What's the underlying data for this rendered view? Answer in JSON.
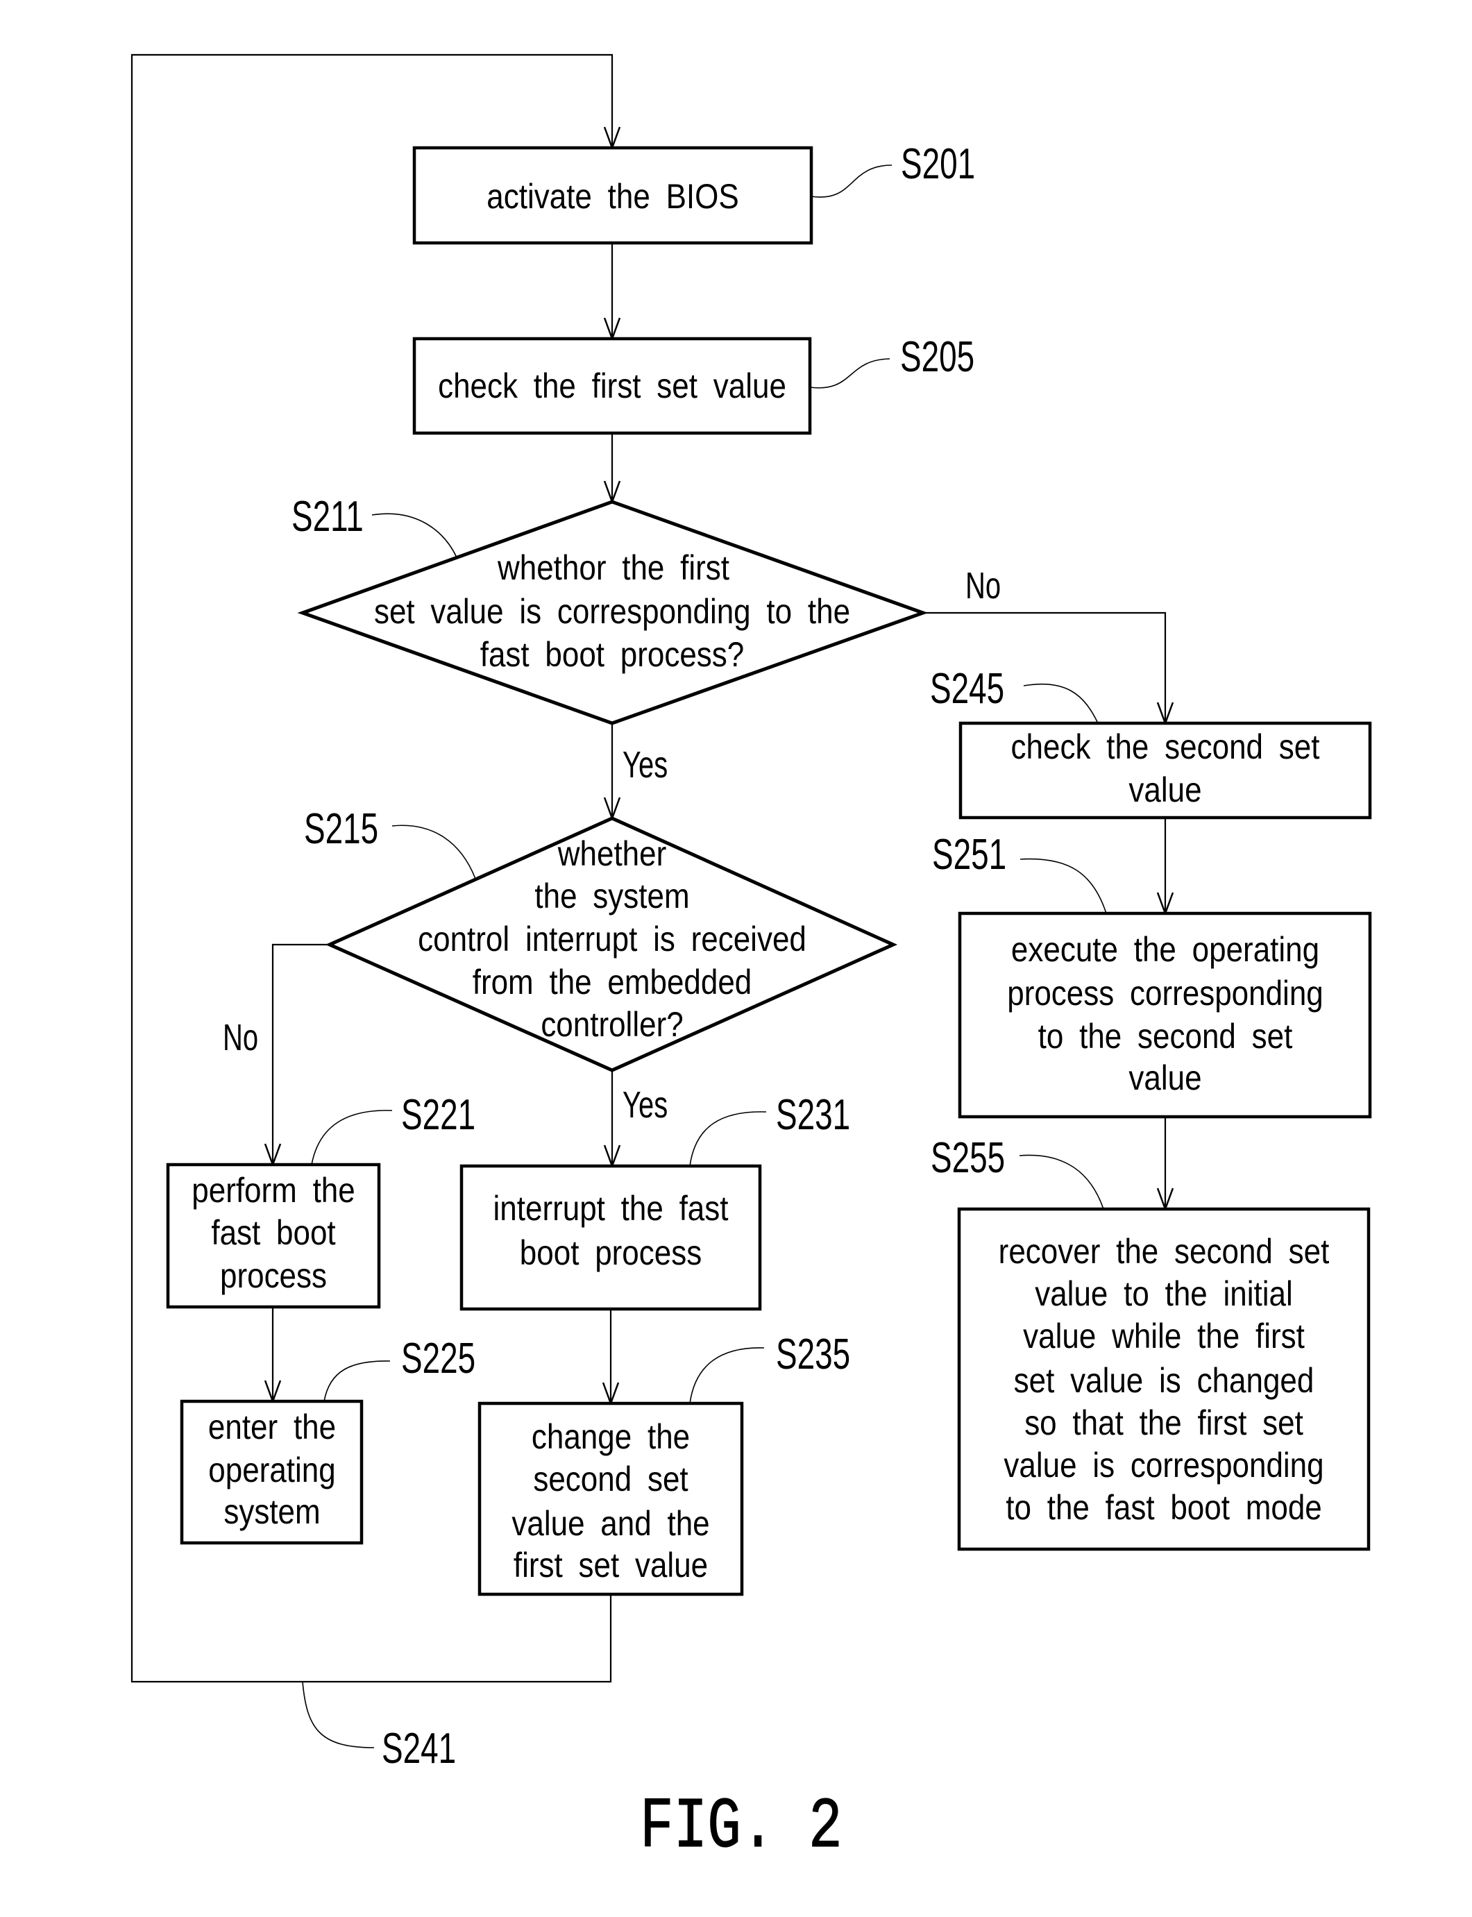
{
  "figure": {
    "caption": "FIG. 2"
  },
  "steps": {
    "S201": {
      "id": "S201",
      "type": "process",
      "lines": [
        "activate the BIOS"
      ]
    },
    "S205": {
      "id": "S205",
      "type": "process",
      "lines": [
        "check the first set value"
      ]
    },
    "S211": {
      "id": "S211",
      "type": "decision",
      "lines": [
        "whethor the first",
        "set value is corresponding to the",
        "fast boot process?"
      ]
    },
    "S215": {
      "id": "S215",
      "type": "decision",
      "lines": [
        "whether",
        "the system",
        "control interrupt is received",
        "from the embedded",
        "controller?"
      ]
    },
    "S221": {
      "id": "S221",
      "type": "process",
      "lines": [
        "perform the",
        "fast boot",
        "process"
      ]
    },
    "S225": {
      "id": "S225",
      "type": "process",
      "lines": [
        "enter the",
        "operating",
        "system"
      ]
    },
    "S231": {
      "id": "S231",
      "type": "process",
      "lines": [
        "interrupt the fast",
        "boot process"
      ]
    },
    "S235": {
      "id": "S235",
      "type": "process",
      "lines": [
        "change the",
        "second set",
        "value and the",
        "first set value"
      ]
    },
    "S241": {
      "id": "S241",
      "type": "loop",
      "lines": []
    },
    "S245": {
      "id": "S245",
      "type": "process",
      "lines": [
        "check the second set",
        "value"
      ]
    },
    "S251": {
      "id": "S251",
      "type": "process",
      "lines": [
        "execute the operating",
        "process corresponding",
        "to the second set",
        "value"
      ]
    },
    "S255": {
      "id": "S255",
      "type": "process",
      "lines": [
        "recover the second set",
        "value to the initial",
        "value while the first",
        "set value is changed",
        "so that the first set",
        "value is corresponding",
        "to the fast boot mode"
      ]
    }
  },
  "branches": {
    "S211_yes": "Yes",
    "S211_no": "No",
    "S215_yes": "Yes",
    "S215_no": "No"
  },
  "edges": [
    {
      "from": "S201",
      "to": "S205"
    },
    {
      "from": "S205",
      "to": "S211"
    },
    {
      "from": "S211",
      "to": "S215",
      "label": "Yes"
    },
    {
      "from": "S211",
      "to": "S245",
      "label": "No"
    },
    {
      "from": "S215",
      "to": "S231",
      "label": "Yes"
    },
    {
      "from": "S215",
      "to": "S221",
      "label": "No"
    },
    {
      "from": "S221",
      "to": "S225"
    },
    {
      "from": "S231",
      "to": "S235"
    },
    {
      "from": "S235",
      "to": "S201",
      "label": "S241"
    },
    {
      "from": "S245",
      "to": "S251"
    },
    {
      "from": "S251",
      "to": "S255"
    }
  ]
}
